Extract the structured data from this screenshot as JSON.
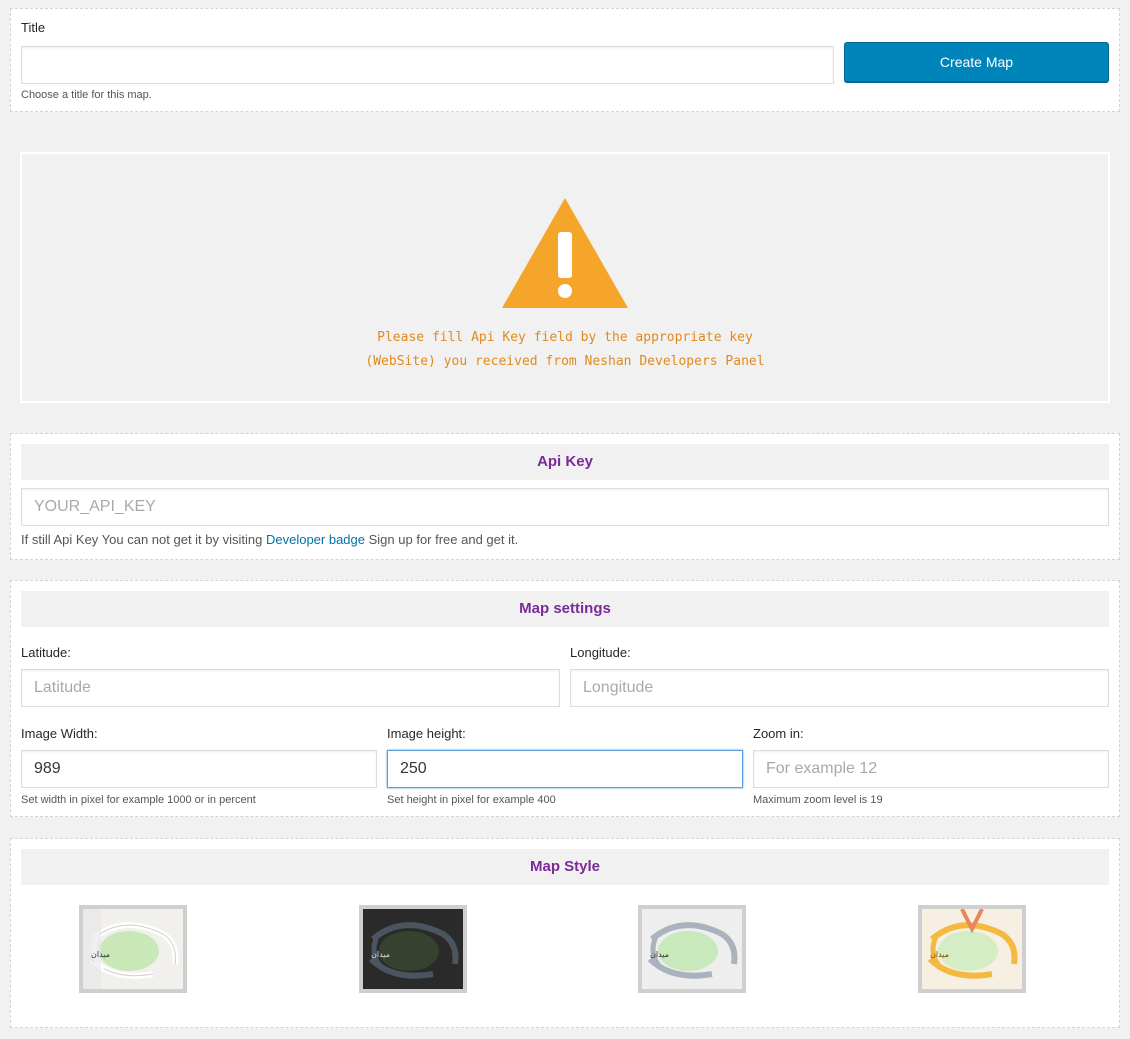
{
  "title_section": {
    "label": "Title",
    "input_value": "",
    "hint": "Choose a title for this map.",
    "create_button": "Create Map"
  },
  "warning": {
    "line1": "Please fill Api Key field by the appropriate key",
    "line2": "(WebSite) you received from Neshan Developers Panel",
    "color": "#f6a52b"
  },
  "api_key": {
    "heading": "Api Key",
    "placeholder": "YOUR_API_KEY",
    "help_prefix": "If still Api Key You can not get it by visiting ",
    "help_link": "Developer badge",
    "help_suffix": " Sign up for free and get it."
  },
  "map_settings": {
    "heading": "Map settings",
    "latitude_label": "Latitude:",
    "latitude_placeholder": "Latitude",
    "longitude_label": "Longitude:",
    "longitude_placeholder": "Longitude",
    "width_label": "Image Width:",
    "width_value": "989",
    "width_hint": "Set width in pixel for example 1000 or in percent",
    "height_label": "Image height:",
    "height_value": "250",
    "height_hint": "Set height in pixel for example 400",
    "zoom_label": "Zoom in:",
    "zoom_placeholder": "For example 12",
    "zoom_hint": "Maximum zoom level is 19"
  },
  "map_style": {
    "heading": "Map Style",
    "styles": [
      {
        "name": "standard-day",
        "label_text": "میدان"
      },
      {
        "name": "standard-night",
        "label_text": "میدان"
      },
      {
        "name": "neshan",
        "label_text": "میدان"
      },
      {
        "name": "dreamy-gold",
        "label_text": "میدان"
      }
    ]
  },
  "colors": {
    "heading": "#7b2a9a",
    "primary_button": "#0085ba",
    "link": "#0073aa"
  }
}
